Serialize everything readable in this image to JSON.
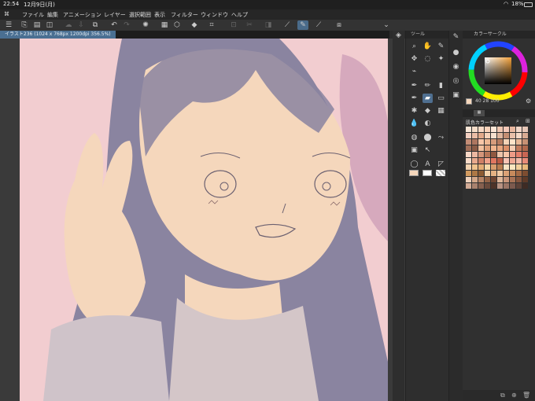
{
  "status": {
    "time": "22:54",
    "date": "12月9日(月)",
    "battery": "18%"
  },
  "menu": [
    "ファイル",
    "編集",
    "アニメーション",
    "レイヤー",
    "選択範囲",
    "表示",
    "フィルター",
    "ウィンドウ",
    "ヘルプ"
  ],
  "canvas_tab": {
    "label": "イラスト236 (1024 x 768px 1200dpi 356.5%)"
  },
  "tool_panel": {
    "title": "ツール"
  },
  "color_panel": {
    "title": "カラーサークル",
    "readout": "40  28  100",
    "palette_tab": "肌色カラーセット"
  },
  "colors": {
    "canvas_bg": "#f2cdd0",
    "skin": "#f5d7bc",
    "hair": "#8a84a0",
    "active_accent": "#4f6f90"
  },
  "palette": [
    "#f8e6d6",
    "#f5dcc8",
    "#f7d9c4",
    "#f9d2b9",
    "#fce6d6",
    "#f0c6b0",
    "#f4c8b8",
    "#e9b8a0",
    "#f2d6c7",
    "#e6c6b6",
    "#f2cfc0",
    "#ebbda6",
    "#e1a98a",
    "#f6d2b9",
    "#f7e1cf",
    "#dfb79f",
    "#c48e73",
    "#e8bfa9",
    "#f4d7c5",
    "#d8ab92",
    "#c48d76",
    "#ad7660",
    "#f7c6a8",
    "#eeb894",
    "#d79c7c",
    "#b67b60",
    "#f4d2b6",
    "#ffe3c9",
    "#e9b896",
    "#c79174",
    "#a2705a",
    "#8a5b46",
    "#f2c09e",
    "#e0a17b",
    "#f2b58e",
    "#e7a57e",
    "#dc8f69",
    "#f7cdb3",
    "#c27b5d",
    "#b0694d",
    "#f7d8c7",
    "#edb8a1",
    "#d4957a",
    "#b77658",
    "#8f5840",
    "#edc4aa",
    "#f7c5a8",
    "#ee9b86",
    "#e57e6a",
    "#c86553",
    "#f9dbc8",
    "#e8a98d",
    "#cf8066",
    "#f0a28a",
    "#e07660",
    "#bb5a44",
    "#f7c4b5",
    "#efa893",
    "#f2b9a7",
    "#e88b78",
    "#f3d3b1",
    "#f0c38d",
    "#e4ad76",
    "#f6d8a8",
    "#d89d6d",
    "#b87c50",
    "#f8e4c5",
    "#fbe6c0",
    "#f2cf9a",
    "#e9b87a",
    "#d19a5f",
    "#ad7845",
    "#8c5b33",
    "#f3d1aa",
    "#e5b282",
    "#f1caa3",
    "#dba276",
    "#c78a5c",
    "#a66b45",
    "#7d4d30",
    "#efd1bb",
    "#d4a88a",
    "#b58365",
    "#936347",
    "#6f4632",
    "#dfb79a",
    "#c8957a",
    "#a87356",
    "#85553d",
    "#5e3a28",
    "#d2ab96",
    "#a9826e",
    "#86604f",
    "#6a4a3c",
    "#4d3328",
    "#b89383",
    "#9b7566",
    "#7c5a4e",
    "#5d4238",
    "#3e2b24"
  ]
}
